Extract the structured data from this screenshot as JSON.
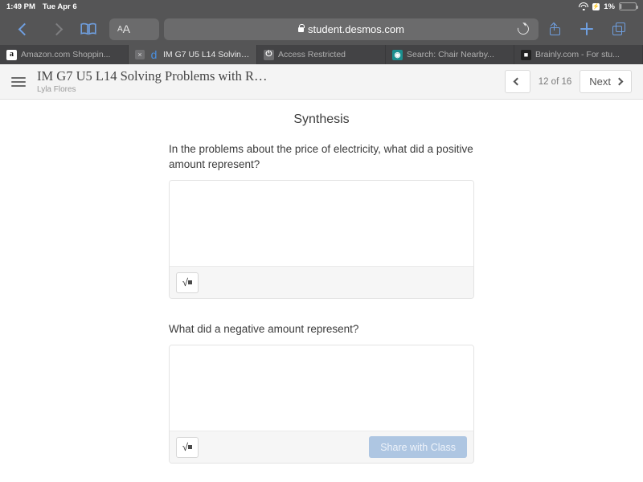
{
  "status_bar": {
    "time": "1:49 PM",
    "date": "Tue Apr 6",
    "wifi_icon": "wifi-icon",
    "charging_icon": "charging-bolt-icon",
    "battery_percent": "1%",
    "battery_icon": "battery-icon"
  },
  "browser": {
    "back_icon": "back-chevron-icon",
    "forward_icon": "forward-chevron-icon",
    "bookmarks_icon": "book-icon",
    "text_size_label": "A",
    "text_size_label_large": "A",
    "url": "student.desmos.com",
    "lock_icon": "lock-icon",
    "reload_icon": "reload-icon",
    "share_icon": "share-icon",
    "new_tab_icon": "plus-icon",
    "tabs_icon": "tabs-overview-icon",
    "tabs": [
      {
        "title": "Amazon.com Shoppin...",
        "favicon": "a",
        "active": false
      },
      {
        "title": "IM G7 U5 L14 Solving...",
        "favicon": "d",
        "active": true,
        "close_label": "×"
      },
      {
        "title": "Access Restricted",
        "favicon": "⏻",
        "active": false
      },
      {
        "title": "Search: Chair Nearby...",
        "favicon": "◉",
        "active": false
      },
      {
        "title": "Brainly.com - For stu...",
        "favicon": "■",
        "active": false
      }
    ]
  },
  "app_header": {
    "menu_icon": "hamburger-menu-icon",
    "title": "IM G7 U5 L14 Solving Problems with R…",
    "author": "Lyla Flores",
    "prev_label": "‹",
    "page_indicator": "12 of 16",
    "next_label": "Next"
  },
  "screen": {
    "title": "Synthesis",
    "questions": [
      {
        "prompt": "In the problems about the price of electricity, what did a positive amount represent?",
        "answer_value": "",
        "math_button_label": "√",
        "has_share_button": false
      },
      {
        "prompt": "What did a negative amount represent?",
        "answer_value": "",
        "math_button_label": "√",
        "has_share_button": true,
        "share_label": "Share with Class"
      }
    ]
  },
  "colors": {
    "chrome_bg": "#555556",
    "tabstrip_bg": "#434345",
    "accent_blue": "#6f9fe0",
    "share_button_bg": "#aec6e2",
    "header_bg": "#f4f4f4"
  }
}
